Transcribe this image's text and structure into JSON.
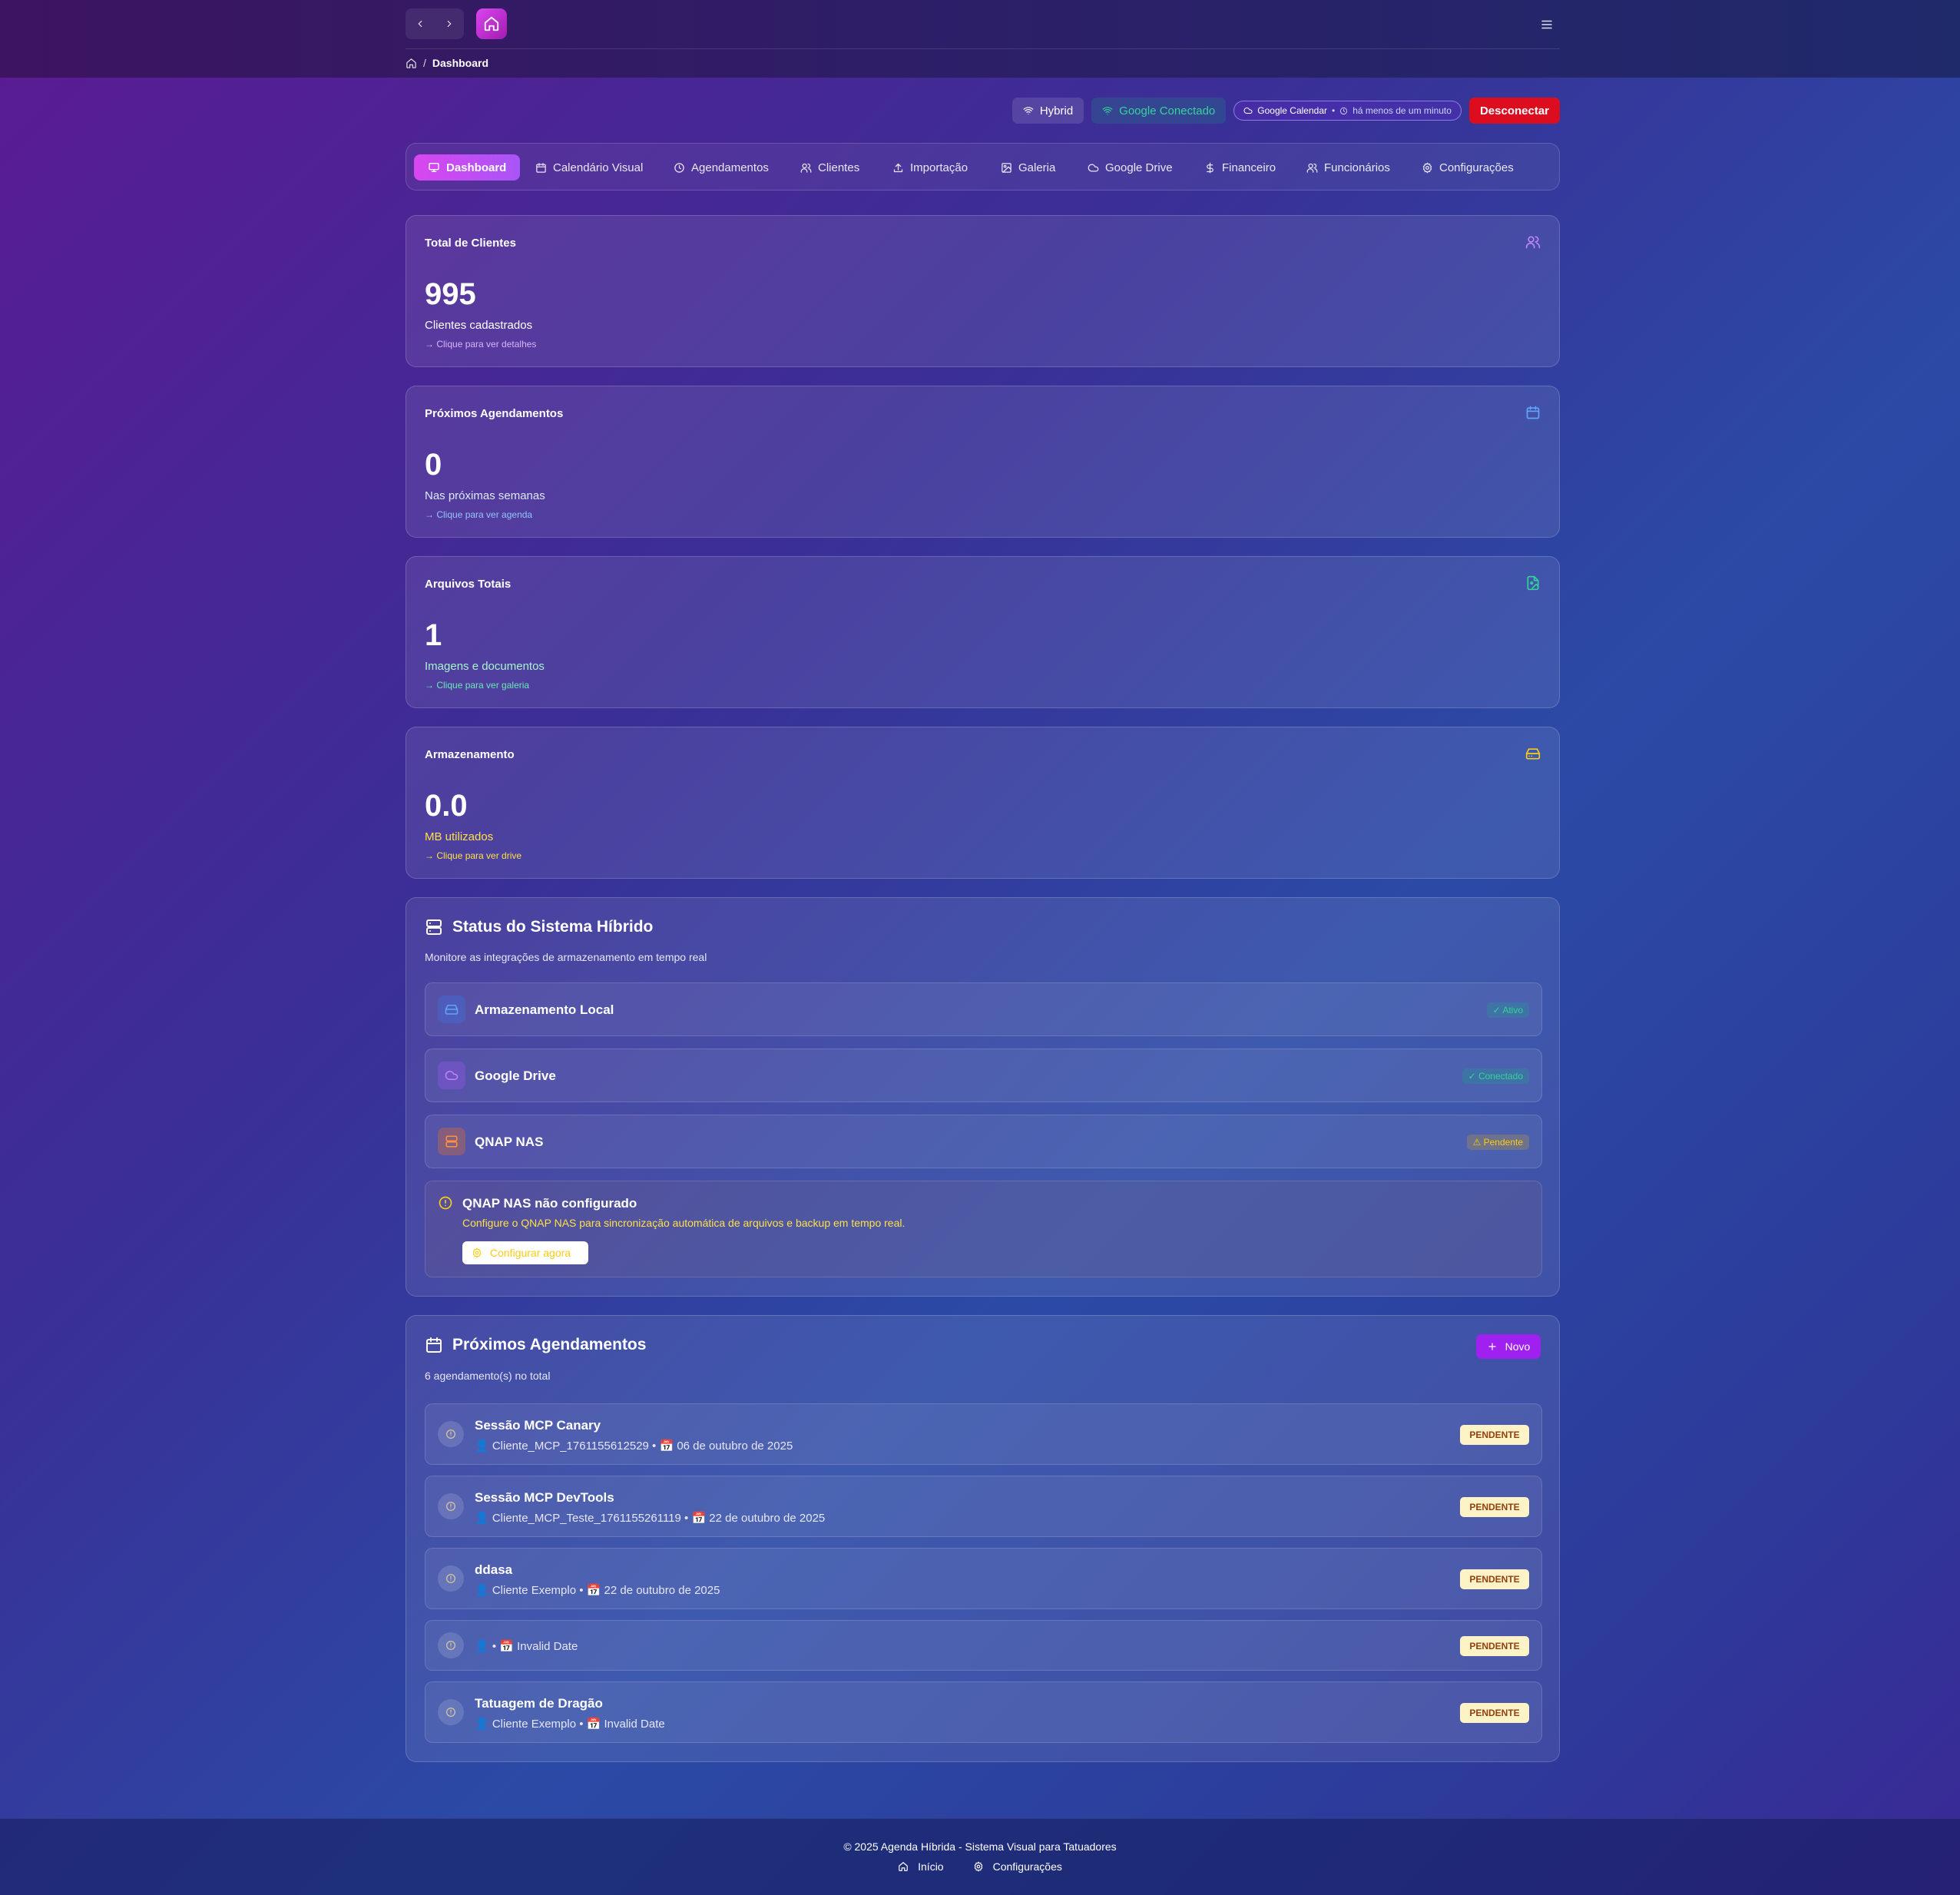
{
  "breadcrumb": {
    "current": "Dashboard"
  },
  "status": {
    "hybrid": "Hybrid",
    "google": "Google Conectado",
    "calendar_label": "Google Calendar",
    "calendar_time": "há menos de um minuto",
    "disconnect": "Desconectar"
  },
  "tabs": [
    {
      "label": "Dashboard",
      "icon": "monitor-icon"
    },
    {
      "label": "Calendário Visual",
      "icon": "calendar-icon"
    },
    {
      "label": "Agendamentos",
      "icon": "clock-icon"
    },
    {
      "label": "Clientes",
      "icon": "users-icon"
    },
    {
      "label": "Importação",
      "icon": "upload-icon"
    },
    {
      "label": "Galeria",
      "icon": "image-icon"
    },
    {
      "label": "Google Drive",
      "icon": "cloud-icon"
    },
    {
      "label": "Financeiro",
      "icon": "dollar-icon"
    },
    {
      "label": "Funcionários",
      "icon": "users-icon"
    },
    {
      "label": "Configurações",
      "icon": "gear-icon"
    }
  ],
  "stats": [
    {
      "title": "Total de Clientes",
      "value": "995",
      "subtitle": "Clientes cadastrados",
      "link": "Clique para ver detalhes",
      "color": "#c084fc",
      "icon": "users-icon"
    },
    {
      "title": "Próximos Agendamentos",
      "value": "0",
      "subtitle": "Nas próximas semanas",
      "link": "Clique para ver agenda",
      "color": "#60a5fa",
      "icon": "calendar-icon"
    },
    {
      "title": "Arquivos Totais",
      "value": "1",
      "subtitle": "Imagens e documentos",
      "link": "Clique para ver galeria",
      "color": "#34d399",
      "icon": "file-image-icon"
    },
    {
      "title": "Armazenamento",
      "value": "0.0",
      "subtitle": "MB utilizados",
      "link": "Clique para ver drive",
      "color": "#facc15",
      "icon": "hard-drive-icon"
    }
  ],
  "hybrid_status": {
    "title": "Status do Sistema Híbrido",
    "description": "Monitore as integrações de armazenamento em tempo real",
    "items": [
      {
        "name": "Armazenamento Local",
        "badge": "✓ Ativo",
        "badge_type": "green",
        "icon": "hard-drive-icon"
      },
      {
        "name": "Google Drive",
        "badge": "✓ Conectado",
        "badge_type": "green",
        "icon": "cloud-icon"
      },
      {
        "name": "QNAP NAS",
        "badge": "⚠ Pendente",
        "badge_type": "yellow",
        "icon": "server-icon"
      }
    ],
    "warning": {
      "title": "QNAP NAS não configurado",
      "text": "Configure o QNAP NAS para sincronização automática de arquivos e backup em tempo real.",
      "button": "Configurar agora"
    }
  },
  "appointments": {
    "title": "Próximos Agendamentos",
    "count_text": "6 agendamento(s) no total",
    "new_button": "Novo",
    "items": [
      {
        "title": "Sessão MCP Canary",
        "meta": "👤 Cliente_MCP_1761155612529 • 📅 06 de outubro de 2025",
        "status": "PENDENTE"
      },
      {
        "title": "Sessão MCP DevTools",
        "meta": "👤 Cliente_MCP_Teste_1761155261119 • 📅 22 de outubro de 2025",
        "status": "PENDENTE"
      },
      {
        "title": "ddasa",
        "meta": "👤 Cliente Exemplo • 📅 22 de outubro de 2025",
        "status": "PENDENTE"
      },
      {
        "title": "",
        "meta": "👤 • 📅 Invalid Date",
        "status": "PENDENTE"
      },
      {
        "title": "Tatuagem de Dragão",
        "meta": "👤 Cliente Exemplo • 📅 Invalid Date",
        "status": "PENDENTE"
      }
    ]
  },
  "footer": {
    "copyright": "© 2025 Agenda Híbrida - Sistema Visual para Tatuadores",
    "links": [
      "Início",
      "Configurações"
    ]
  }
}
